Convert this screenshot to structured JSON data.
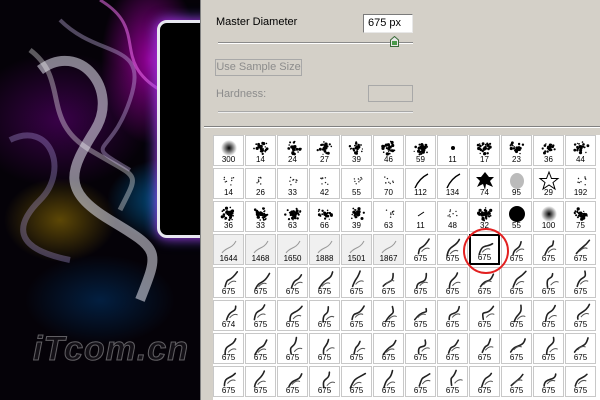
{
  "panel": {
    "master_diameter_label": "Master Diameter",
    "master_diameter_value": "675 px",
    "master_diameter_fraction": 0.9,
    "use_sample_size_label": "Use Sample Size",
    "hardness_label": "Hardness:",
    "hardness_value": ""
  },
  "grid": {
    "columns": 12,
    "selected": {
      "row": 3,
      "col": 8
    },
    "rows": [
      [
        {
          "n": "300",
          "s": "soft"
        },
        {
          "n": "14",
          "s": "spatter"
        },
        {
          "n": "24",
          "s": "spatter"
        },
        {
          "n": "27",
          "s": "spatter"
        },
        {
          "n": "39",
          "s": "spatter"
        },
        {
          "n": "46",
          "s": "spatter"
        },
        {
          "n": "59",
          "s": "spatter"
        },
        {
          "n": "11",
          "s": "dot"
        },
        {
          "n": "17",
          "s": "spatter"
        },
        {
          "n": "23",
          "s": "spatter"
        },
        {
          "n": "36",
          "s": "spatter"
        },
        {
          "n": "44",
          "s": "spatter"
        }
      ],
      [
        {
          "n": "14",
          "s": "speck"
        },
        {
          "n": "26",
          "s": "speck"
        },
        {
          "n": "33",
          "s": "speck"
        },
        {
          "n": "42",
          "s": "speck"
        },
        {
          "n": "55",
          "s": "speck"
        },
        {
          "n": "70",
          "s": "speck"
        },
        {
          "n": "112",
          "s": "grass"
        },
        {
          "n": "134",
          "s": "grass"
        },
        {
          "n": "74",
          "s": "leaf"
        },
        {
          "n": "95",
          "s": "leafsoft"
        },
        {
          "n": "29",
          "s": "star"
        },
        {
          "n": "192",
          "s": "speck"
        }
      ],
      [
        {
          "n": "36",
          "s": "chalk"
        },
        {
          "n": "33",
          "s": "chalk"
        },
        {
          "n": "63",
          "s": "chalk"
        },
        {
          "n": "66",
          "s": "spatter"
        },
        {
          "n": "39",
          "s": "spatter"
        },
        {
          "n": "63",
          "s": "speck"
        },
        {
          "n": "11",
          "s": "tinyline"
        },
        {
          "n": "48",
          "s": "speck"
        },
        {
          "n": "32",
          "s": "chalk"
        },
        {
          "n": "55",
          "s": "hard"
        },
        {
          "n": "100",
          "s": "soft"
        },
        {
          "n": "75",
          "s": "chalk"
        }
      ],
      [
        {
          "n": "1644",
          "s": "faint"
        },
        {
          "n": "1468",
          "s": "faint"
        },
        {
          "n": "1650",
          "s": "faint"
        },
        {
          "n": "1888",
          "s": "faint"
        },
        {
          "n": "1501",
          "s": "faint"
        },
        {
          "n": "1867",
          "s": "faint"
        },
        {
          "n": "675",
          "s": "smoke"
        },
        {
          "n": "675",
          "s": "smoke"
        },
        {
          "n": "675",
          "s": "smoke"
        },
        {
          "n": "675",
          "s": "smoke"
        },
        {
          "n": "675",
          "s": "smoke"
        },
        {
          "n": "675",
          "s": "smoke"
        }
      ],
      [
        {
          "n": "675",
          "s": "smoke"
        },
        {
          "n": "675",
          "s": "smoke"
        },
        {
          "n": "675",
          "s": "smoke"
        },
        {
          "n": "675",
          "s": "smoke"
        },
        {
          "n": "675",
          "s": "smoke"
        },
        {
          "n": "675",
          "s": "smoke"
        },
        {
          "n": "675",
          "s": "smoke"
        },
        {
          "n": "675",
          "s": "smoke"
        },
        {
          "n": "675",
          "s": "smoke"
        },
        {
          "n": "675",
          "s": "smoke"
        },
        {
          "n": "675",
          "s": "smoke"
        },
        {
          "n": "675",
          "s": "smoke"
        }
      ],
      [
        {
          "n": "674",
          "s": "smoke"
        },
        {
          "n": "675",
          "s": "smoke"
        },
        {
          "n": "675",
          "s": "smoke"
        },
        {
          "n": "675",
          "s": "smoke"
        },
        {
          "n": "675",
          "s": "smoke"
        },
        {
          "n": "675",
          "s": "smoke"
        },
        {
          "n": "675",
          "s": "smoke"
        },
        {
          "n": "675",
          "s": "smoke"
        },
        {
          "n": "675",
          "s": "smoke"
        },
        {
          "n": "675",
          "s": "smoke"
        },
        {
          "n": "675",
          "s": "smoke"
        },
        {
          "n": "675",
          "s": "smoke"
        }
      ],
      [
        {
          "n": "675",
          "s": "smoke"
        },
        {
          "n": "675",
          "s": "smoke"
        },
        {
          "n": "675",
          "s": "smoke"
        },
        {
          "n": "675",
          "s": "smoke"
        },
        {
          "n": "675",
          "s": "smoke"
        },
        {
          "n": "675",
          "s": "smoke"
        },
        {
          "n": "675",
          "s": "smoke"
        },
        {
          "n": "675",
          "s": "smoke"
        },
        {
          "n": "675",
          "s": "smoke"
        },
        {
          "n": "675",
          "s": "smoke"
        },
        {
          "n": "675",
          "s": "smoke"
        },
        {
          "n": "675",
          "s": "smoke"
        }
      ],
      [
        {
          "n": "675",
          "s": "smoke"
        },
        {
          "n": "675",
          "s": "smoke"
        },
        {
          "n": "675",
          "s": "smoke"
        },
        {
          "n": "675",
          "s": "smoke"
        },
        {
          "n": "675",
          "s": "smoke"
        },
        {
          "n": "675",
          "s": "smoke"
        },
        {
          "n": "675",
          "s": "smoke"
        },
        {
          "n": "675",
          "s": "smoke"
        },
        {
          "n": "675",
          "s": "smoke"
        },
        {
          "n": "675",
          "s": "smoke"
        },
        {
          "n": "675",
          "s": "smoke"
        },
        {
          "n": "675",
          "s": "smoke"
        }
      ]
    ]
  },
  "watermark": "iTcom.cn",
  "colors": {
    "panel_bg": "#d4d0c8",
    "highlight_ring": "#e22020"
  }
}
